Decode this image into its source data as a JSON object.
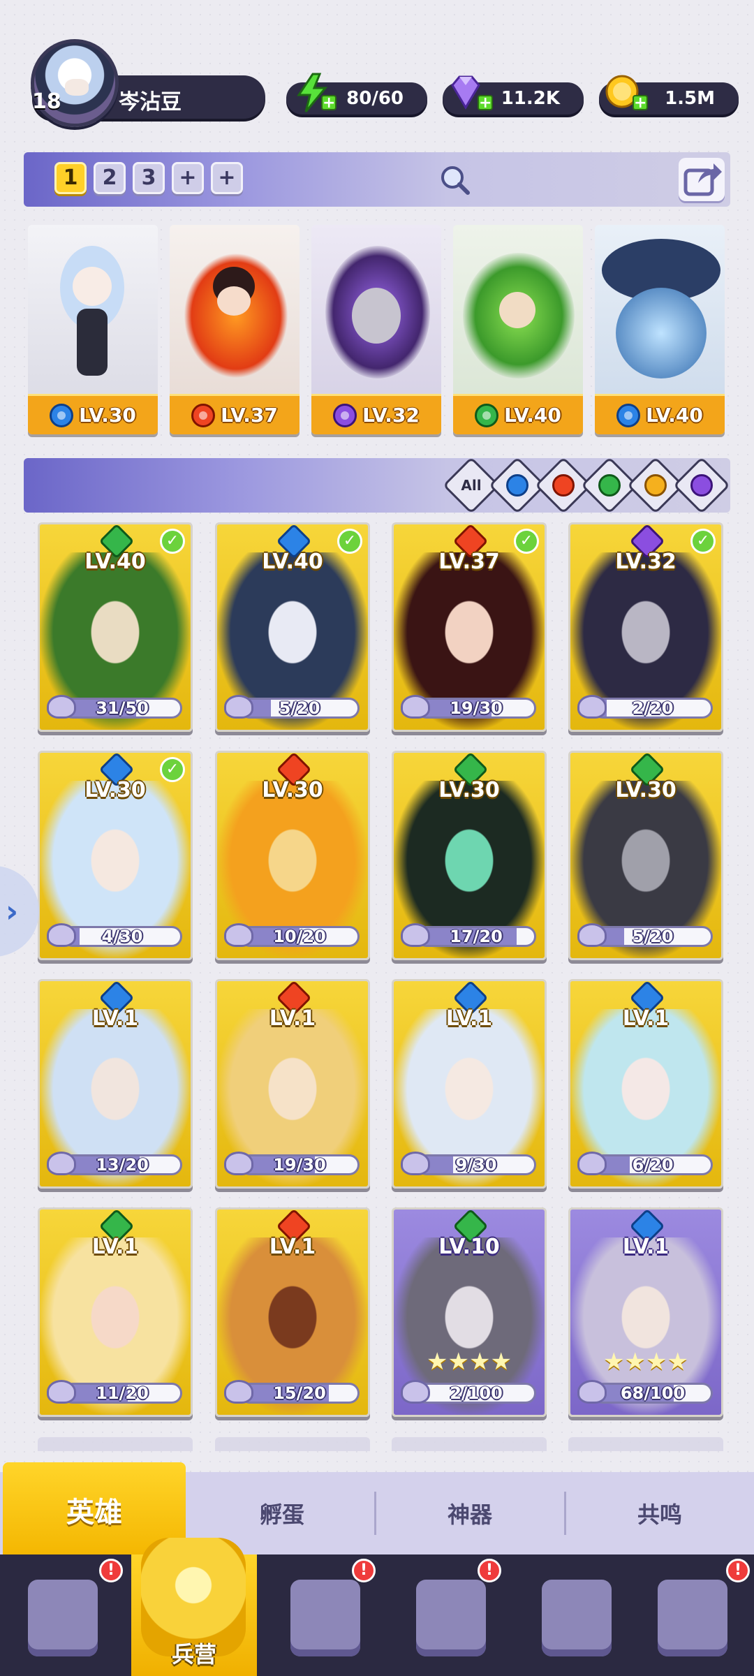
{
  "player": {
    "level": "18",
    "name": "岑沾豆"
  },
  "resources": {
    "energy": "80/60",
    "gems": "11.2K",
    "coins": "1.5M"
  },
  "team_slots": [
    "1",
    "2",
    "3",
    "+",
    "+"
  ],
  "team": [
    {
      "element": "water",
      "level": "LV.30"
    },
    {
      "element": "fire",
      "level": "LV.37"
    },
    {
      "element": "dark",
      "level": "LV.32"
    },
    {
      "element": "wind",
      "level": "LV.40"
    },
    {
      "element": "water",
      "level": "LV.40"
    }
  ],
  "filter": {
    "all_label": "All",
    "elements": [
      "water",
      "fire",
      "wind",
      "light",
      "dark"
    ]
  },
  "heroes": [
    {
      "element": "wind",
      "level": "LV.40",
      "progress": "31/50",
      "fraction": 0.62,
      "in_team": true,
      "card": "gold"
    },
    {
      "element": "water",
      "level": "LV.40",
      "progress": "5/20",
      "fraction": 0.25,
      "in_team": true,
      "card": "gold"
    },
    {
      "element": "fire",
      "level": "LV.37",
      "progress": "19/30",
      "fraction": 0.63,
      "in_team": true,
      "card": "gold"
    },
    {
      "element": "dark",
      "level": "LV.32",
      "progress": "2/20",
      "fraction": 0.1,
      "in_team": true,
      "card": "gold"
    },
    {
      "element": "water",
      "level": "LV.30",
      "progress": "4/30",
      "fraction": 0.13,
      "in_team": true,
      "card": "gold"
    },
    {
      "element": "fire",
      "level": "LV.30",
      "progress": "10/20",
      "fraction": 0.5,
      "in_team": false,
      "card": "gold"
    },
    {
      "element": "wind",
      "level": "LV.30",
      "progress": "17/20",
      "fraction": 0.85,
      "in_team": false,
      "card": "gold"
    },
    {
      "element": "wind",
      "level": "LV.30",
      "progress": "5/20",
      "fraction": 0.25,
      "in_team": false,
      "card": "gold"
    },
    {
      "element": "water",
      "level": "LV.1",
      "progress": "13/20",
      "fraction": 0.65,
      "in_team": false,
      "card": "gold"
    },
    {
      "element": "fire",
      "level": "LV.1",
      "progress": "19/30",
      "fraction": 0.63,
      "in_team": false,
      "card": "gold"
    },
    {
      "element": "water",
      "level": "LV.1",
      "progress": "9/30",
      "fraction": 0.3,
      "in_team": false,
      "card": "gold"
    },
    {
      "element": "water",
      "level": "LV.1",
      "progress": "6/20",
      "fraction": 0.3,
      "in_team": false,
      "card": "gold"
    },
    {
      "element": "wind",
      "level": "LV.1",
      "progress": "11/20",
      "fraction": 0.55,
      "in_team": false,
      "card": "gold"
    },
    {
      "element": "fire",
      "level": "LV.1",
      "progress": "15/20",
      "fraction": 0.75,
      "in_team": false,
      "card": "gold"
    },
    {
      "element": "wind",
      "level": "LV.10",
      "progress": "2/100",
      "fraction": 0.02,
      "in_team": false,
      "card": "purple",
      "stars": "★★★★"
    },
    {
      "element": "water",
      "level": "LV.1",
      "progress": "68/100",
      "fraction": 0.68,
      "in_team": false,
      "card": "purple",
      "stars": "★★★★"
    }
  ],
  "sub_tabs": [
    "英雄",
    "孵蛋",
    "神器",
    "共鸣"
  ],
  "nav": {
    "active_label": "兵营",
    "alert_mark": "!"
  },
  "colors": {
    "water": "#2c83e6",
    "fire": "#ef4422",
    "dark": "#8b4ee0",
    "wind": "#35b64a",
    "light": "#f5b01e",
    "accent_gold": "#ffd028",
    "panel_purple": "#6b66c8"
  }
}
